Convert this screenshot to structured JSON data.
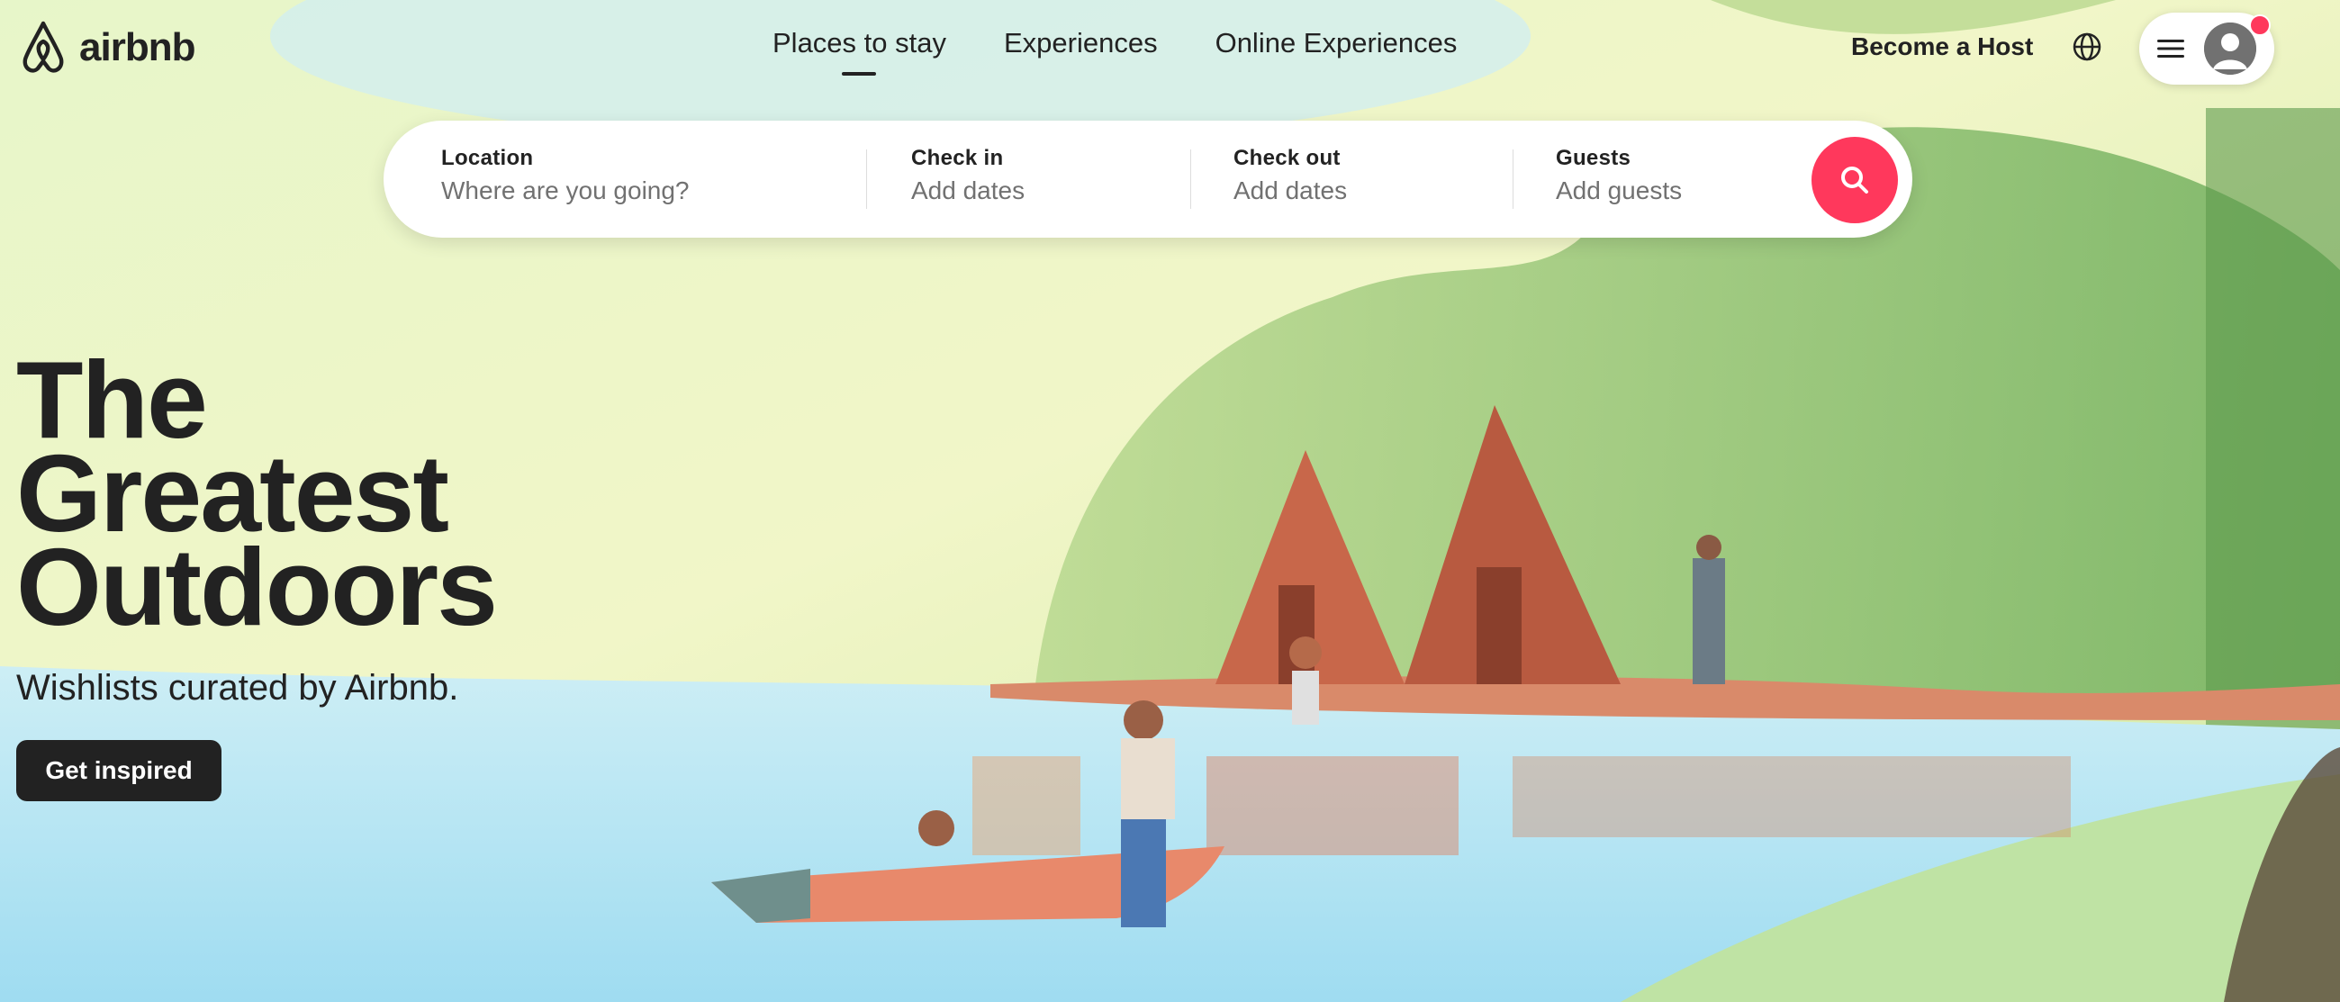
{
  "brand": {
    "name": "airbnb",
    "accent": "#FF385C"
  },
  "nav": {
    "tabs": [
      {
        "label": "Places to stay",
        "active": true
      },
      {
        "label": "Experiences",
        "active": false
      },
      {
        "label": "Online Experiences",
        "active": false
      }
    ]
  },
  "header": {
    "host_label": "Become a Host",
    "globe_icon": "globe-icon",
    "menu_icon": "hamburger-icon",
    "avatar_icon": "user-avatar-icon"
  },
  "search": {
    "location": {
      "label": "Location",
      "placeholder": "Where are you going?"
    },
    "check_in": {
      "label": "Check in",
      "placeholder": "Add dates"
    },
    "check_out": {
      "label": "Check out",
      "placeholder": "Add dates"
    },
    "guests": {
      "label": "Guests",
      "placeholder": "Add guests"
    },
    "button_icon": "search-icon"
  },
  "hero": {
    "title_lines": [
      "The",
      "Greatest",
      "Outdoors"
    ],
    "subtitle": "Wishlists curated by Airbnb.",
    "cta_label": "Get inspired"
  }
}
